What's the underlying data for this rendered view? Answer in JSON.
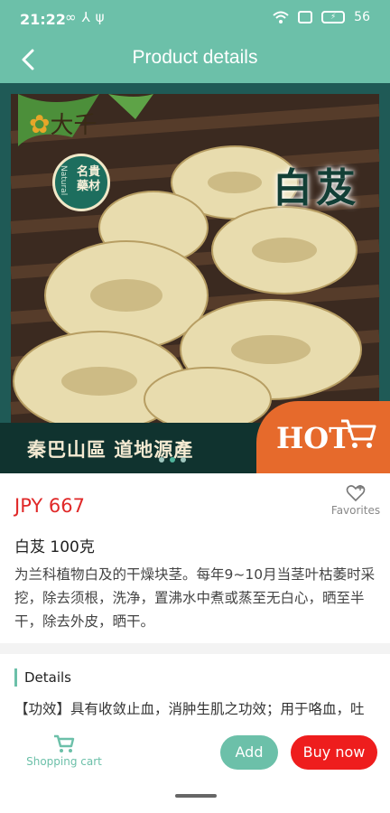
{
  "status_bar": {
    "time": "21:22",
    "left_icons": [
      "infinity-icon",
      "usb-icon",
      "usb-debug-icon"
    ],
    "right_icons": [
      "wifi-icon",
      "sim-icon",
      "battery-charging-icon"
    ],
    "battery": "56"
  },
  "header": {
    "title": "Product details",
    "back_icon": "chevron-left-icon",
    "background": "#6cc0a9"
  },
  "product_image": {
    "brand": "大千",
    "seal_line": "名貴藥材",
    "seal_side": "Natural",
    "title": "白芨",
    "origin": "秦巴山區 道地源產",
    "badge": "HOT",
    "slides": 3,
    "active_slide": 1
  },
  "product": {
    "price": "JPY 667",
    "favorites_label": "Favorites",
    "name": "白芨 100克",
    "description": "为兰科植物白及的干燥块茎。每年9~10月当茎叶枯萎时采挖，除去须根，洗净，置沸水中煮或蒸至无白心，晒至半干，除去外皮，晒干。"
  },
  "details": {
    "title": "Details",
    "text": "【功效】具有收敛止血，消肿生肌之功效；用于咯血，吐血，外伤出血，疮疡肿毒，皮肤皲裂"
  },
  "bottom_bar": {
    "cart_label": "Shopping cart",
    "add_label": "Add",
    "buy_label": "Buy now"
  },
  "colors": {
    "accent": "#6cc0a9",
    "price": "#e02828",
    "buy": "#ee1d1d",
    "hot_badge": "#e66a2c"
  }
}
